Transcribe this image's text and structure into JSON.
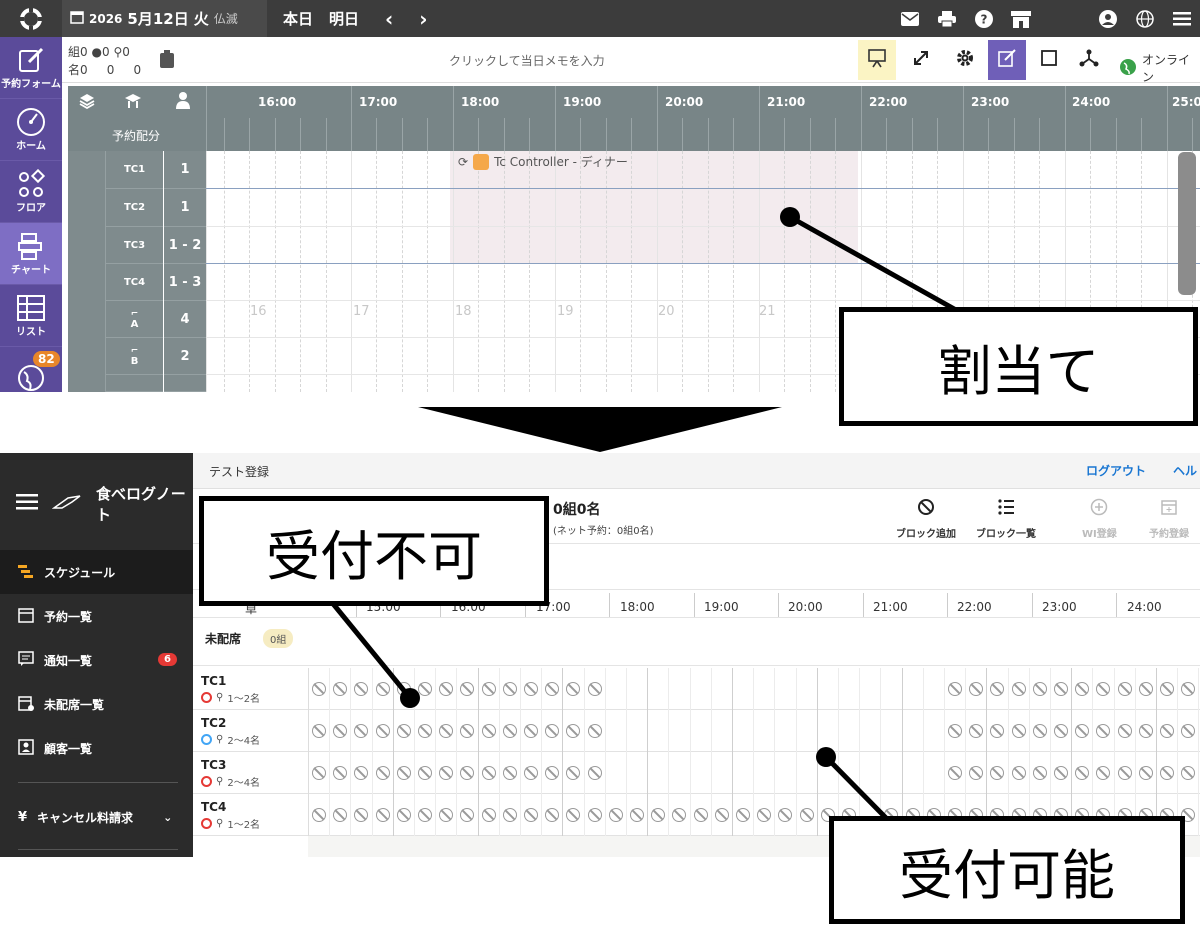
{
  "top": {
    "date": {
      "year": "2026",
      "md": "5月12日",
      "weekday": "火",
      "rokuyo": "仏滅"
    },
    "today_label": "本日",
    "tomorrow_label": "明日",
    "sidebar": [
      {
        "label": "予約フォーム",
        "icon": "edit-icon"
      },
      {
        "label": "ホーム",
        "icon": "gauge-icon"
      },
      {
        "label": "フロア",
        "icon": "floor-icon"
      },
      {
        "label": "チャート",
        "icon": "chart-icon"
      },
      {
        "label": "リスト",
        "icon": "list-icon"
      },
      {
        "label": "",
        "icon": "globe-icon",
        "badge": "82"
      }
    ],
    "counts": {
      "kumi_label": "組",
      "kumi": "0",
      "web": "0",
      "walk": "0",
      "mei_label": "名",
      "mei": "0",
      "mei_web": "0",
      "mei_walk": "0"
    },
    "memo_placeholder": "クリックして当日メモを入力",
    "online_label": "オンライン",
    "alloc_label": "予約配分",
    "hours": [
      "16:00",
      "17:00",
      "18:00",
      "19:00",
      "20:00",
      "21:00",
      "22:00",
      "23:00",
      "24:00",
      "25:0"
    ],
    "ghost_hours": [
      "16",
      "17",
      "18",
      "19",
      "20",
      "21"
    ],
    "rows": [
      {
        "name": "TC1",
        "cap": "1"
      },
      {
        "name": "TC2",
        "cap": "1"
      },
      {
        "name": "TC3",
        "cap": "1 - 2"
      },
      {
        "name": "TC4",
        "cap": "1 - 3"
      },
      {
        "name": "A",
        "cap": "4"
      },
      {
        "name": "B",
        "cap": "2"
      }
    ],
    "reservation_label": "Tc Controller - ディナー"
  },
  "bottom": {
    "brand": "食べログノート",
    "nav": [
      {
        "label": "スケジュール",
        "icon": "schedule-icon"
      },
      {
        "label": "予約一覧",
        "icon": "calendar-icon"
      },
      {
        "label": "通知一覧",
        "icon": "message-icon",
        "badge": "6"
      },
      {
        "label": "未配席一覧",
        "icon": "calendar-plus-icon"
      },
      {
        "label": "顧客一覧",
        "icon": "contact-icon"
      },
      {
        "label": "キャンセル料請求",
        "icon": "yen-icon"
      }
    ],
    "page_title": "テスト登録",
    "logout": "ログアウト",
    "help": "ヘル",
    "summary_main": "0組0名",
    "summary_sub": "(ネット予約：0組0名)",
    "actions": [
      {
        "label": "ブロック追加",
        "icon": "block-icon",
        "enabled": true
      },
      {
        "label": "ブロック一覧",
        "icon": "list-icon",
        "enabled": true
      },
      {
        "label": "WI登録",
        "icon": "plus-circle-icon",
        "enabled": false
      },
      {
        "label": "予約登録",
        "icon": "calendar-add-icon",
        "enabled": false
      }
    ],
    "header_left": "卓",
    "hours": [
      "15:00",
      "16:00",
      "17:00",
      "18:00",
      "19:00",
      "20:00",
      "21:00",
      "22:00",
      "23:00",
      "24:00"
    ],
    "unassigned_label": "未配席",
    "unassigned_count": "0組",
    "tables": [
      {
        "name": "TC1",
        "cap": "1〜2名",
        "status": "red"
      },
      {
        "name": "TC2",
        "cap": "2〜4名",
        "status": "blue"
      },
      {
        "name": "TC3",
        "cap": "2〜4名",
        "status": "red"
      },
      {
        "name": "TC4",
        "cap": "1〜2名",
        "status": "red"
      }
    ]
  },
  "callouts": {
    "assign": "割当て",
    "not_accept": "受付不可",
    "accept": "受付可能"
  }
}
